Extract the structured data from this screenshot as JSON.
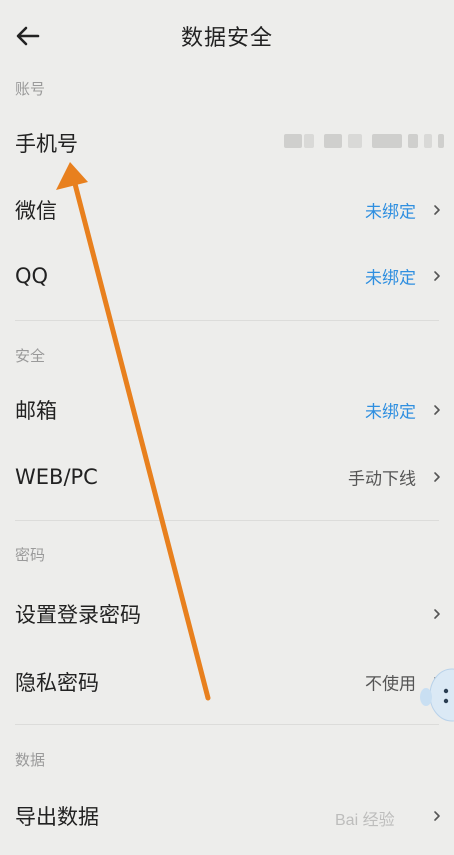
{
  "header": {
    "title": "数据安全",
    "back_icon": "arrow-left-icon"
  },
  "sections": {
    "account": {
      "label": "账号",
      "phone": {
        "label": "手机号",
        "value_masked": true
      },
      "wechat": {
        "label": "微信",
        "value": "未绑定"
      },
      "qq": {
        "label": "QQ",
        "value": "未绑定"
      }
    },
    "security": {
      "label": "安全",
      "email": {
        "label": "邮箱",
        "value": "未绑定"
      },
      "webpc": {
        "label": "WEB/PC",
        "value": "手动下线"
      }
    },
    "password": {
      "label": "密码",
      "login_password": {
        "label": "设置登录密码"
      },
      "privacy_password": {
        "label": "隐私密码",
        "value": "不使用"
      }
    },
    "data": {
      "label": "数据",
      "export": {
        "label": "导出数据"
      }
    }
  },
  "colors": {
    "background": "#ededeb",
    "link_blue": "#2f8fe0",
    "annotation_arrow": "#e8801e"
  },
  "watermark": {
    "text": "Bai 经验"
  }
}
